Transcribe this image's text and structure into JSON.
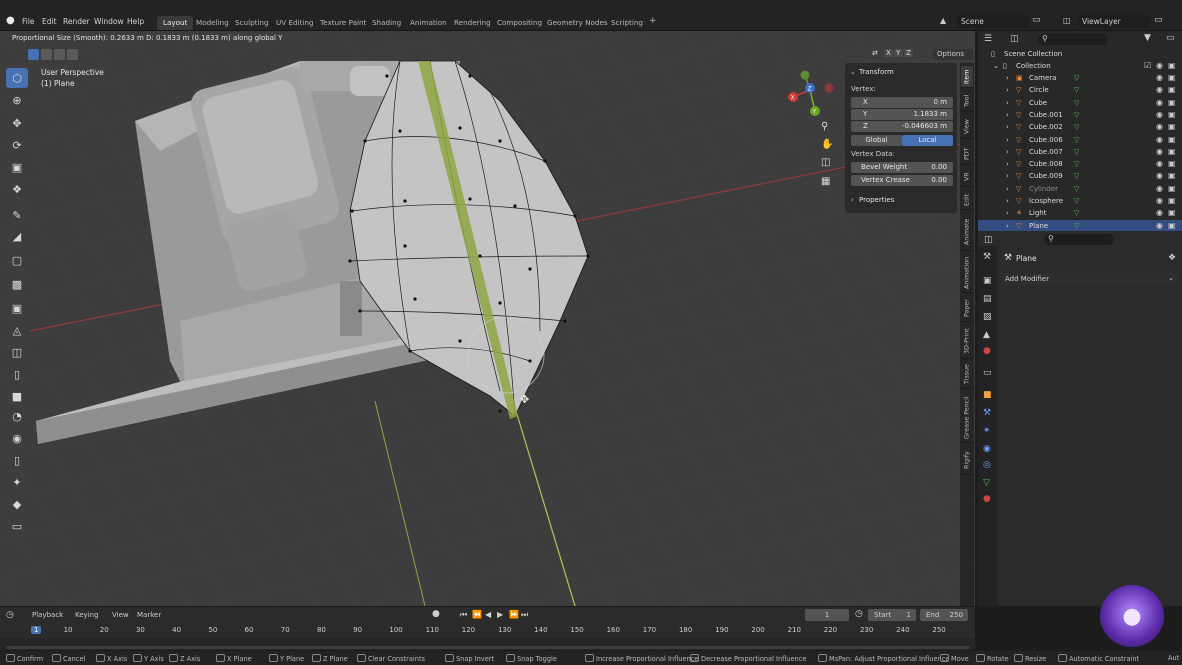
{
  "topbar": {
    "menus": [
      "File",
      "Edit",
      "Render",
      "Window",
      "Help"
    ],
    "workspaces": [
      "Layout",
      "Modeling",
      "Sculpting",
      "UV Editing",
      "Texture Paint",
      "Shading",
      "Animation",
      "Rendering",
      "Compositing",
      "Geometry Nodes",
      "Scripting"
    ],
    "active_workspace": "Layout",
    "add_tab": "+",
    "scene_name": "Scene",
    "view_layer": "ViewLayer"
  },
  "header": {
    "status_text": "Proportional Size (Smooth): 0.2633 m    D: 0.1833 m (0.1833 m) along global Y",
    "axes": [
      "X",
      "Y",
      "Z"
    ],
    "options_label": "Options"
  },
  "viewport": {
    "view_name": "User Perspective",
    "object_name": "(1) Plane",
    "gizmo_labels": [
      "Y",
      "Z",
      "X"
    ]
  },
  "npanel": {
    "transform_title": "Transform",
    "vertex_label": "Vertex:",
    "x_label": "X",
    "x_value": "0 m",
    "y_label": "Y",
    "y_value": "1.1833 m",
    "z_label": "Z",
    "z_value": "-0.046603 m",
    "global_label": "Global",
    "local_label": "Local",
    "vertex_data_label": "Vertex Data:",
    "bevel_weight_label": "Bevel Weight",
    "bevel_weight_value": "0.00",
    "vertex_crease_label": "Vertex Crease",
    "vertex_crease_value": "0.00",
    "properties_title": "Properties"
  },
  "sidebar_tabs": [
    "Item",
    "Tool",
    "View",
    "PDT",
    "VR",
    "Edit",
    "Animate",
    "Animation",
    "Paper",
    "3D-Print",
    "Tissue",
    "Grease Pencil",
    "Rigify"
  ],
  "outliner": {
    "root": "Scene Collection",
    "collection": "Collection",
    "items": [
      "Camera",
      "Circle",
      "Cube",
      "Cube.001",
      "Cube.002",
      "Cube.006",
      "Cube.007",
      "Cube.008",
      "Cube.009",
      "Cylinder",
      "Icosphere",
      "Light",
      "Plane"
    ],
    "selected": "Plane"
  },
  "properties": {
    "object_name": "Plane",
    "add_modifier_label": "Add Modifier"
  },
  "timeline": {
    "menus": [
      "Playback",
      "Keying",
      "View",
      "Marker"
    ],
    "current_frame": "1",
    "start_label": "Start",
    "start_value": "1",
    "end_label": "End",
    "end_value": "250",
    "ruler": [
      "1",
      "10",
      "20",
      "30",
      "40",
      "50",
      "60",
      "70",
      "80",
      "90",
      "100",
      "110",
      "120",
      "130",
      "140",
      "150",
      "160",
      "170",
      "180",
      "190",
      "200",
      "210",
      "220",
      "230",
      "240",
      "250"
    ]
  },
  "statusbar": {
    "items": [
      "Confirm",
      "Cancel",
      "X Axis",
      "Y Axis",
      "Z Axis",
      "X Plane",
      "Y Plane",
      "Z Plane",
      "Clear Constraints",
      "Snap Invert",
      "Snap Toggle",
      "Increase Proportional Influence",
      "Decrease Proportional Influence",
      "MsPan: Adjust Proportional Influence",
      "Move",
      "Rotate",
      "Resize",
      "Automatic Constraint"
    ],
    "suffix": "Aut"
  },
  "colors": {
    "accent": "#4772b3",
    "viewport_bg": "#3d3d3d",
    "axis_red": "#a83a3a",
    "axis_green": "#8fa642",
    "selected_row": "#334d80"
  },
  "icons": [
    "blender-logo-icon",
    "select-box-icon",
    "cursor-icon",
    "move-icon",
    "rotate-icon",
    "scale-icon",
    "transform-icon",
    "annotate-icon",
    "measure-icon",
    "add-cube-icon",
    "extrude-icon",
    "inset-icon",
    "bevel-icon",
    "loop-cut-icon",
    "knife-icon",
    "poly-build-icon",
    "spin-icon",
    "smooth-icon",
    "edge-slide-icon",
    "shrink-fatten-icon",
    "shear-icon",
    "rip-icon",
    "zoom-icon",
    "hand-pan-icon",
    "camera-view-icon",
    "grid-view-icon",
    "eye-icon",
    "camera-render-icon",
    "play-icon",
    "filter-icon",
    "pin-icon",
    "wrench-icon",
    "avatar-icon"
  ]
}
